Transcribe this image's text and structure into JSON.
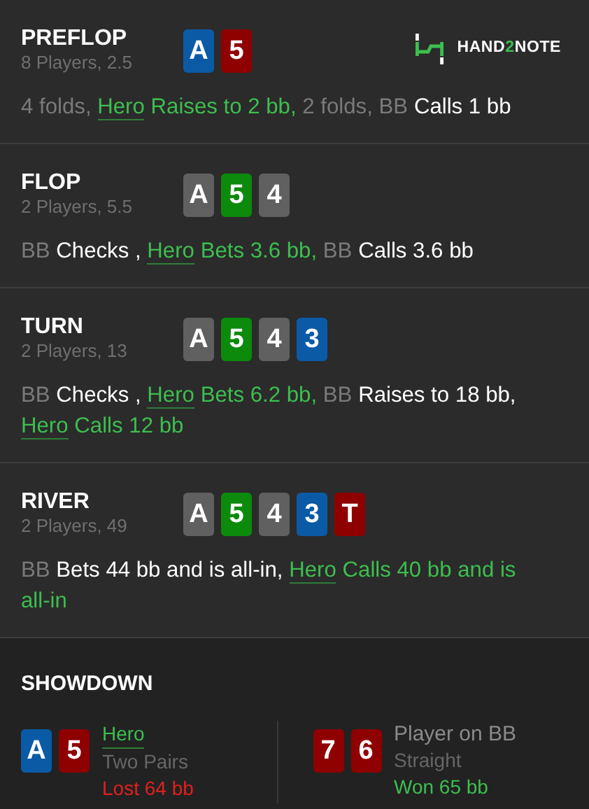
{
  "logo": {
    "parts": [
      {
        "text": "HAND",
        "accent": false
      },
      {
        "text": "2",
        "accent": true
      },
      {
        "text": "NOTE",
        "accent": false
      }
    ]
  },
  "streets": [
    {
      "title": "PREFLOP",
      "info": "8 Players, 2.5",
      "cards": [
        {
          "rank": "A",
          "color": "#0b5aa6"
        },
        {
          "rank": "5",
          "color": "#8f0000"
        }
      ],
      "actions": [
        {
          "text": "4 folds,",
          "kind": "muted"
        },
        {
          "text": "Hero",
          "kind": "hero_link"
        },
        {
          "text": "Raises to 2 bb,",
          "kind": "hero"
        },
        {
          "text": "2 folds,",
          "kind": "muted"
        },
        {
          "text": "BB",
          "kind": "muted"
        },
        {
          "text": "Calls 1 bb",
          "kind": "plain"
        }
      ]
    },
    {
      "title": "FLOP",
      "info": "2 Players, 5.5",
      "cards": [
        {
          "rank": "A",
          "color": "#606060"
        },
        {
          "rank": "5",
          "color": "#0c8a0c"
        },
        {
          "rank": "4",
          "color": "#606060"
        }
      ],
      "actions": [
        {
          "text": "BB",
          "kind": "muted"
        },
        {
          "text": "Checks ,",
          "kind": "plain"
        },
        {
          "text": "Hero",
          "kind": "hero_link"
        },
        {
          "text": "Bets 3.6 bb,",
          "kind": "hero"
        },
        {
          "text": "BB",
          "kind": "muted"
        },
        {
          "text": "Calls 3.6 bb",
          "kind": "plain"
        }
      ]
    },
    {
      "title": "TURN",
      "info": "2 Players, 13",
      "cards": [
        {
          "rank": "A",
          "color": "#606060"
        },
        {
          "rank": "5",
          "color": "#0c8a0c"
        },
        {
          "rank": "4",
          "color": "#606060"
        },
        {
          "rank": "3",
          "color": "#0b5aa6"
        }
      ],
      "actions": [
        {
          "text": "BB",
          "kind": "muted"
        },
        {
          "text": "Checks ,",
          "kind": "plain"
        },
        {
          "text": "Hero",
          "kind": "hero_link"
        },
        {
          "text": "Bets 6.2 bb,",
          "kind": "hero"
        },
        {
          "text": "BB",
          "kind": "muted"
        },
        {
          "text": "Raises to 18 bb,",
          "kind": "plain"
        },
        {
          "text": "Hero",
          "kind": "hero_link"
        },
        {
          "text": "Calls 12 bb",
          "kind": "hero"
        }
      ]
    },
    {
      "title": "RIVER",
      "info": "2 Players, 49",
      "cards": [
        {
          "rank": "A",
          "color": "#606060"
        },
        {
          "rank": "5",
          "color": "#0c8a0c"
        },
        {
          "rank": "4",
          "color": "#606060"
        },
        {
          "rank": "3",
          "color": "#0b5aa6"
        },
        {
          "rank": "T",
          "color": "#8f0000"
        }
      ],
      "actions": [
        {
          "text": "BB",
          "kind": "muted"
        },
        {
          "text": "Bets 44 bb and is all-in,",
          "kind": "plain"
        },
        {
          "text": "Hero",
          "kind": "hero_link"
        },
        {
          "text": "Calls 40 bb and is all-in",
          "kind": "hero"
        }
      ]
    }
  ],
  "showdown": {
    "title": "SHOWDOWN",
    "players": [
      {
        "name": "Hero",
        "is_hero": true,
        "hand": "Two Pairs",
        "result": "Lost 64 bb",
        "won": false,
        "cards": [
          {
            "rank": "A",
            "color": "#0b5aa6"
          },
          {
            "rank": "5",
            "color": "#8f0000"
          }
        ]
      },
      {
        "name": "Player on BB",
        "is_hero": false,
        "hand": "Straight",
        "result": "Won 65 bb",
        "won": true,
        "cards": [
          {
            "rank": "7",
            "color": "#8f0000"
          },
          {
            "rank": "6",
            "color": "#8f0000"
          }
        ]
      }
    ]
  }
}
